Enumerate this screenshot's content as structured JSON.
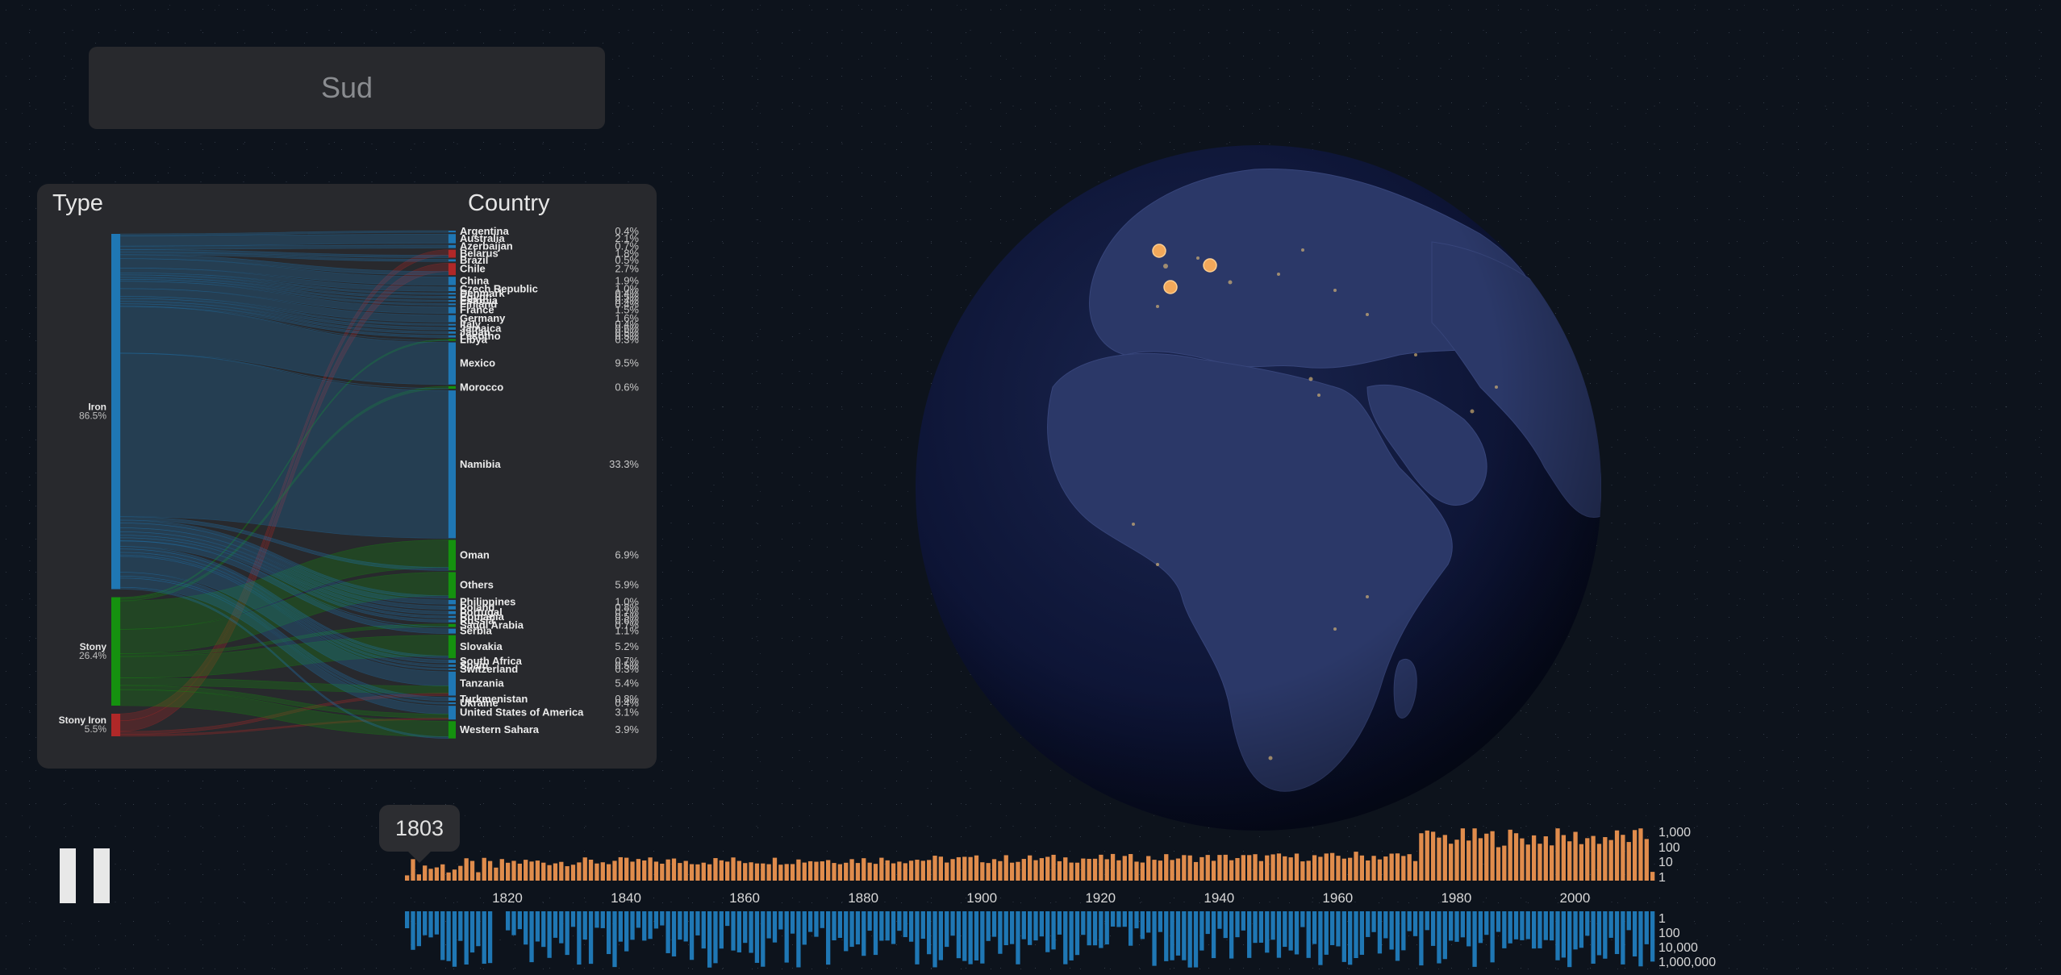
{
  "search": {
    "value": "Sud"
  },
  "panel": {
    "type_header": "Type",
    "country_header": "Country",
    "types": [
      {
        "label": "Iron",
        "pct": "86.5%",
        "color": "#1f77b4"
      },
      {
        "label": "Stony",
        "pct": "26.4%",
        "color": "#15910f"
      },
      {
        "label": "Stony Iron",
        "pct": "5.5%",
        "color": "#b02828"
      }
    ],
    "countries": [
      {
        "name": "Argentina",
        "pct": "0.4%"
      },
      {
        "name": "Australia",
        "pct": "2.1%"
      },
      {
        "name": "Azerbaijan",
        "pct": "0.7%"
      },
      {
        "name": "Belarus",
        "pct": "1.8%"
      },
      {
        "name": "Brazil",
        "pct": "0.5%"
      },
      {
        "name": "Chile",
        "pct": "2.7%"
      },
      {
        "name": "China",
        "pct": "1.9%"
      },
      {
        "name": "Czech Republic",
        "pct": "1.0%"
      },
      {
        "name": "Denmark",
        "pct": "0.4%"
      },
      {
        "name": "Egypt",
        "pct": "0.5%"
      },
      {
        "name": "Estonia",
        "pct": "0.4%"
      },
      {
        "name": "Finland",
        "pct": "0.4%"
      },
      {
        "name": "France",
        "pct": "1.5%"
      },
      {
        "name": "Germany",
        "pct": "1.6%"
      },
      {
        "name": "Italy",
        "pct": "0.4%"
      },
      {
        "name": "Jamaica",
        "pct": "0.6%"
      },
      {
        "name": "Japan",
        "pct": "0.5%"
      },
      {
        "name": "Lesotho",
        "pct": "0.5%"
      },
      {
        "name": "Libya",
        "pct": "0.3%"
      },
      {
        "name": "Mexico",
        "pct": "9.5%"
      },
      {
        "name": "Morocco",
        "pct": "0.6%"
      },
      {
        "name": "Namibia",
        "pct": "33.3%"
      },
      {
        "name": "Oman",
        "pct": "6.9%"
      },
      {
        "name": "Others",
        "pct": "5.9%"
      },
      {
        "name": "Philippines",
        "pct": "1.0%"
      },
      {
        "name": "Poland",
        "pct": "0.8%"
      },
      {
        "name": "Portugal",
        "pct": "0.7%"
      },
      {
        "name": "Romania",
        "pct": "0.5%"
      },
      {
        "name": "Russia",
        "pct": "0.6%"
      },
      {
        "name": "Saudi Arabia",
        "pct": "0.7%"
      },
      {
        "name": "Serbia",
        "pct": "1.1%"
      },
      {
        "name": "Slovakia",
        "pct": "5.2%"
      },
      {
        "name": "South Africa",
        "pct": "0.7%"
      },
      {
        "name": "Spain",
        "pct": "0.5%"
      },
      {
        "name": "Switzerland",
        "pct": "0.3%"
      },
      {
        "name": "Tanzania",
        "pct": "5.4%"
      },
      {
        "name": "Turkmenistan",
        "pct": "0.8%"
      },
      {
        "name": "Ukraine",
        "pct": "0.4%"
      },
      {
        "name": "United States of America",
        "pct": "3.1%"
      },
      {
        "name": "Western Sahara",
        "pct": "3.9%"
      }
    ]
  },
  "player": {
    "state": "playing",
    "current_year": "1803"
  },
  "timeline": {
    "x_ticks": [
      "1820",
      "1840",
      "1860",
      "1880",
      "1900",
      "1920",
      "1940",
      "1960",
      "1980",
      "2000"
    ],
    "count_axis_ticks": [
      "1,000",
      "100",
      "10",
      "1"
    ],
    "mass_axis_ticks": [
      "1",
      "100",
      "10,000",
      "1,000,000"
    ],
    "count_color": "#e08c4c",
    "mass_color": "#1f77b4"
  },
  "colors": {
    "panel_bg": "#28292d",
    "iron": "#1f77b4",
    "stony": "#15910f",
    "stony_iron": "#b02828"
  }
}
